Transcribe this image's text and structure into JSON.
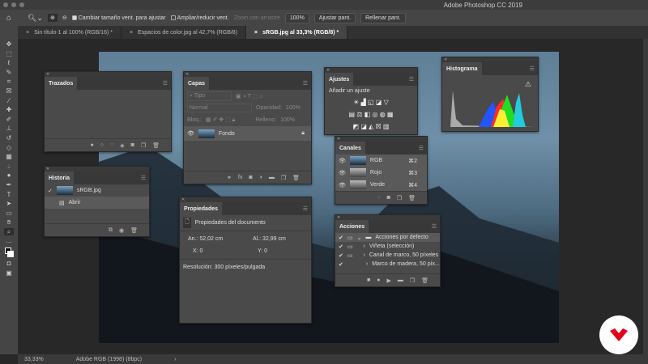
{
  "app": {
    "title": "Adobe Photoshop CC 2019"
  },
  "options": {
    "home": "home-icon",
    "resize_label": "Cambiar tamaño vent. para ajustar",
    "resize_checked": true,
    "zoom_all_label": "Ampliar/reducir vent.",
    "zoom_all_checked": false,
    "scrubby_label": "Zoom con arrastre",
    "zoom_100": "100%",
    "fit_screen": "Ajustar pant.",
    "fill_screen": "Rellenar pant."
  },
  "tabs": [
    {
      "label": "Sin título-1 al 100% (RGB/16) *"
    },
    {
      "label": "Espacios de color.jpg al 42,7% (RGB/8)"
    },
    {
      "label": "sRGB.jpg al 33,3% (RGB/8) *",
      "active": true
    }
  ],
  "status": {
    "zoom": "33,33%",
    "profile": "Adobe RGB (1998) (8bpc)",
    "arrow": "›"
  },
  "trazados": {
    "title": "Trazados"
  },
  "historia": {
    "title": "Historia",
    "items": [
      {
        "label": "sRGB.jpg"
      },
      {
        "label": "Abrir"
      }
    ]
  },
  "capas": {
    "title": "Capas",
    "filter": "Tipo",
    "blend": "Normal",
    "opacity_label": "Opacidad:",
    "opacity": "100%",
    "lock_label": "Bloq.:",
    "fill_label": "Relleno:",
    "fill": "100%",
    "layer": "Fondo"
  },
  "ajustes": {
    "title": "Ajustes",
    "subtitle": "Añadir un ajuste"
  },
  "canales": {
    "title": "Canales",
    "items": [
      {
        "name": "RGB",
        "shortcut": "⌘2"
      },
      {
        "name": "Rojo",
        "shortcut": "⌘3"
      },
      {
        "name": "Verde",
        "shortcut": "⌘4"
      }
    ]
  },
  "histograma": {
    "title": "Histograma",
    "warning": "⚠"
  },
  "propiedades": {
    "title": "Propiedades",
    "subtitle": "Propiedades del documento",
    "width": "An.: 52,02 cm",
    "height": "Al.: 32,99 cm",
    "x": "X: 0",
    "y": "Y: 0",
    "resolution": "Resolución: 300 píxeles/pulgada"
  },
  "acciones": {
    "title": "Acciones",
    "items": [
      {
        "label": "Acciones por defecto",
        "folder": true
      },
      {
        "label": "Viñeta (selección)"
      },
      {
        "label": "Canal de marco, 50 píxeles"
      },
      {
        "label": "Marco de madera, 50 píx..."
      }
    ]
  }
}
